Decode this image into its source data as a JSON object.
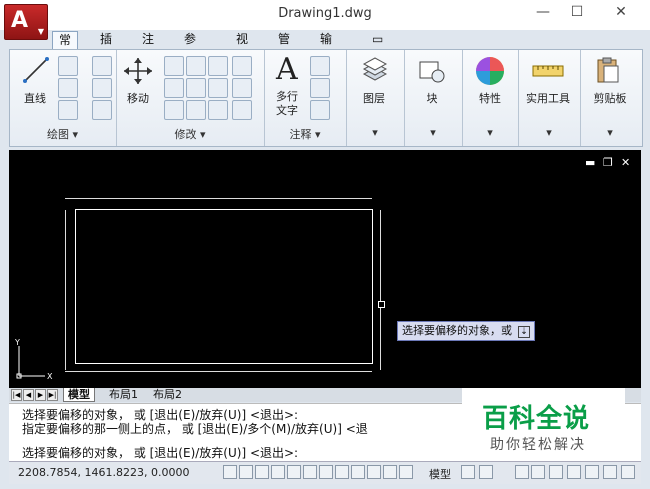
{
  "window": {
    "title": "Drawing1.dwg",
    "minimize": "—",
    "maximize": "☐",
    "close": "✕"
  },
  "ribbon_tabs": [
    "常用",
    "插入",
    "注释",
    "参数化",
    "视图",
    "管理",
    "输出",
    "▭"
  ],
  "panels": {
    "draw": {
      "title": "绘图",
      "line": "直线"
    },
    "modify": {
      "title": "修改",
      "move": "移动"
    },
    "annotation": {
      "title": "注释",
      "multiline_text_1": "多行",
      "multiline_text_2": "文字"
    },
    "layers": {
      "label": "图层"
    },
    "block": {
      "label": "块"
    },
    "properties": {
      "label": "特性"
    },
    "utilities": {
      "label": "实用工具"
    },
    "clipboard": {
      "label": "剪贴板"
    }
  },
  "canvas": {
    "tooltip": "选择要偏移的对象，或"
  },
  "ucs": {
    "x": "X",
    "y": "Y"
  },
  "layout_tabs": [
    "模型",
    "布局1",
    "布局2"
  ],
  "command_lines": [
    "选择要偏移的对象， 或 [退出(E)/放弃(U)] <退出>:",
    "指定要偏移的那一侧上的点， 或 [退出(E)/多个(M)/放弃(U)] <退",
    "选择要偏移的对象， 或 [退出(E)/放弃(U)] <退出>:"
  ],
  "status": {
    "coordinates": "2208.7854, 1461.8223, 0.0000",
    "model": "模型"
  },
  "watermark": {
    "brand": "百科全说",
    "tagline": "助你轻松解决"
  },
  "colors": {
    "accent": "#c92a2a",
    "brand_green": "#0a9e48",
    "tooltip_bg": "#d8dcf0"
  }
}
